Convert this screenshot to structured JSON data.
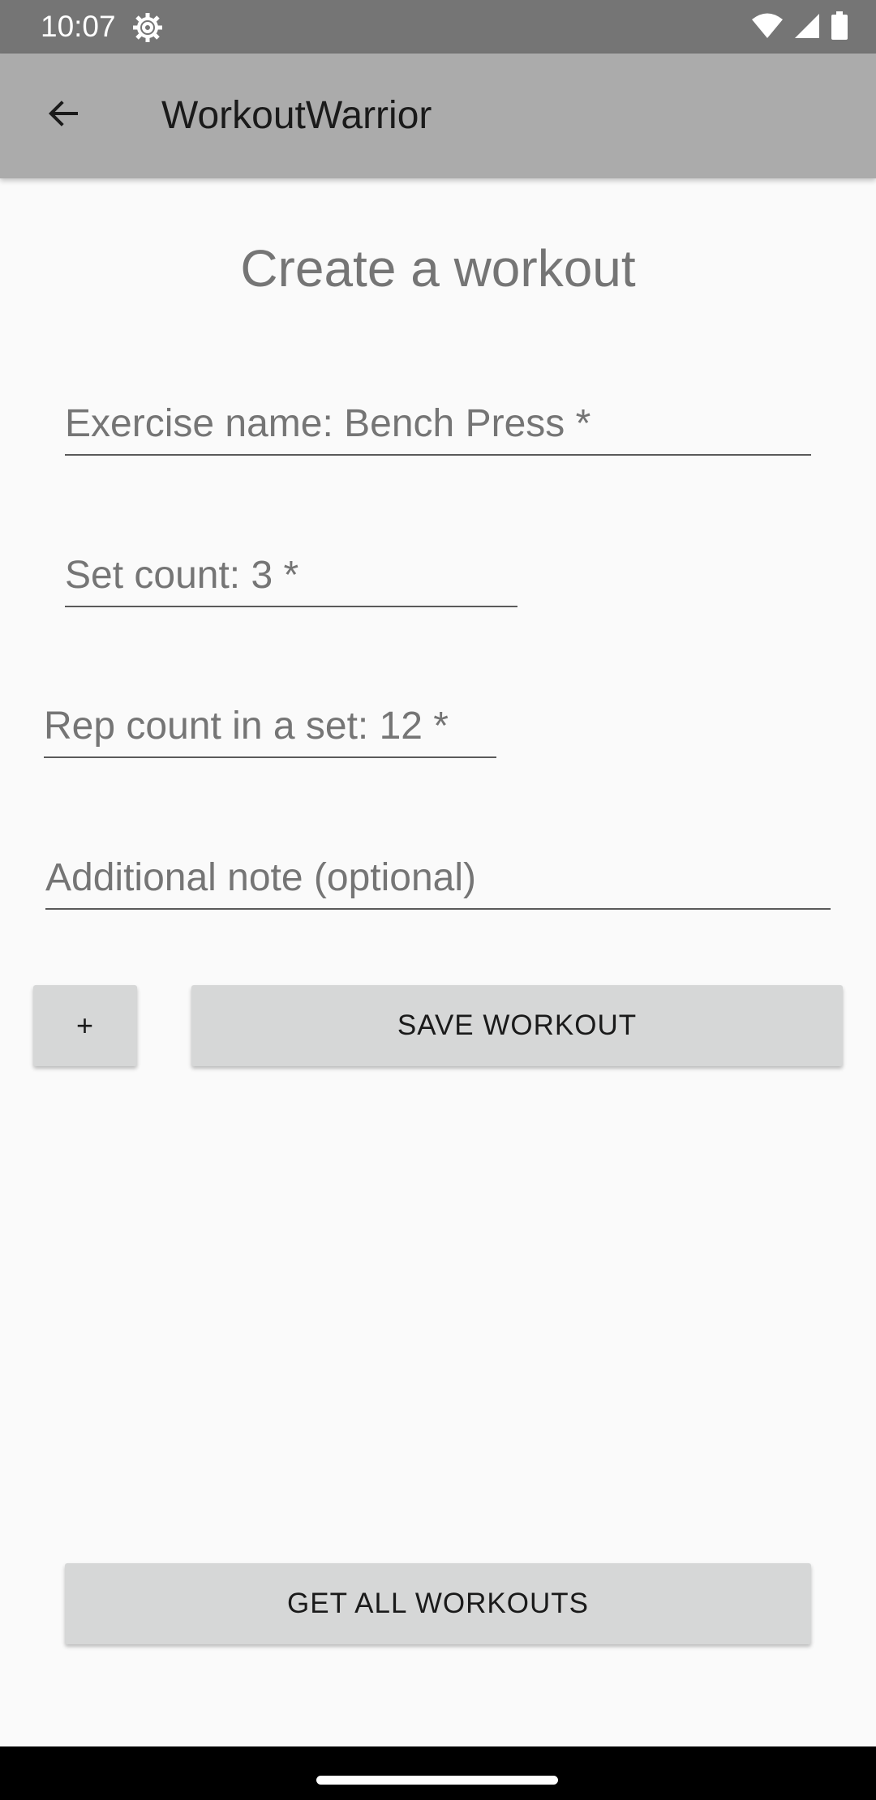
{
  "status_bar": {
    "time": "10:07",
    "icons": [
      "settings-gear-icon",
      "wifi-icon",
      "signal-icon",
      "battery-icon"
    ]
  },
  "app_bar": {
    "title": "WorkoutWarrior",
    "back_icon": "arrow-back-icon",
    "background": "#ababab"
  },
  "main": {
    "heading": "Create a workout",
    "fields": {
      "exercise_name_placeholder": "Exercise name: Bench Press *",
      "set_count_placeholder": "Set count: 3 *",
      "rep_count_placeholder": "Rep count in a set: 12 *",
      "note_placeholder": "Additional note (optional)"
    },
    "add_button_label": "+",
    "save_button_label": "SAVE WORKOUT",
    "get_all_button_label": "GET ALL WORKOUTS"
  },
  "colors": {
    "status_bar": "#757575",
    "background": "#fafafa",
    "button": "#d6d7d7",
    "heading_text": "#757575"
  }
}
